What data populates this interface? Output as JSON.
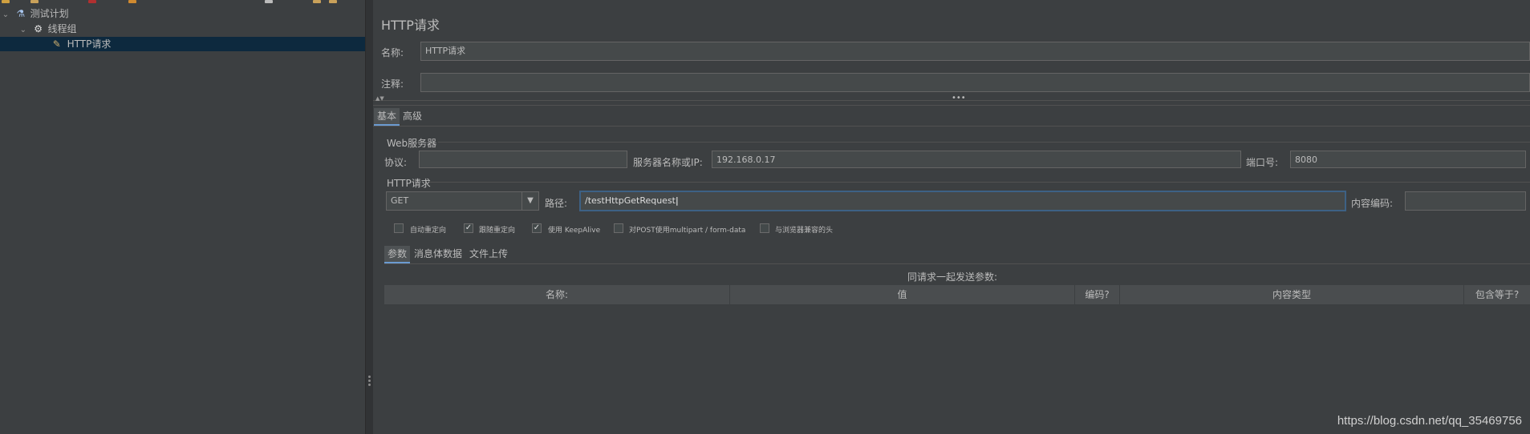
{
  "tree": {
    "items": [
      {
        "label": "测试计划",
        "icon": "flask-icon"
      },
      {
        "label": "线程组",
        "icon": "gear-icon"
      },
      {
        "label": "HTTP请求",
        "icon": "pipette-icon"
      }
    ]
  },
  "panel": {
    "title": "HTTP请求",
    "name_label": "名称:",
    "name_value": "HTTP请求",
    "comment_label": "注释:",
    "comment_value": "",
    "tabs": [
      "基本",
      "高级"
    ],
    "web_server": {
      "section_title": "Web服务器",
      "protocol_label": "协议:",
      "protocol_value": "",
      "server_label": "服务器名称或IP:",
      "server_value": "192.168.0.17",
      "port_label": "端口号:",
      "port_value": "8080"
    },
    "http_request": {
      "section_title": "HTTP请求",
      "method": "GET",
      "path_label": "路径:",
      "path_value": "/testHttpGetRequest",
      "encoding_label": "内容编码:",
      "encoding_value": ""
    },
    "checkboxes": [
      {
        "label": "自动重定向",
        "checked": false
      },
      {
        "label": "跟随重定向",
        "checked": true
      },
      {
        "label": "使用 KeepAlive",
        "checked": true
      },
      {
        "label": "对POST使用multipart / form-data",
        "checked": false
      },
      {
        "label": "与浏览器兼容的头",
        "checked": false
      }
    ],
    "sub_tabs": [
      "参数",
      "消息体数据",
      "文件上传"
    ],
    "params_caption": "同请求一起发送参数:",
    "table_headers": [
      "名称:",
      "值",
      "编码?",
      "内容类型",
      "包含等于?"
    ]
  },
  "watermark": "https://blog.csdn.net/qq_35469756",
  "colors": {
    "background": "#3c3f41",
    "selection": "#0d293e",
    "focus_border": "#3d6185",
    "active_tab_underline": "#6b9bd1"
  }
}
